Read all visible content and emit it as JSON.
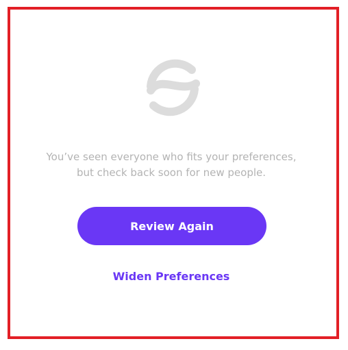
{
  "empty_state": {
    "icon": "swap-circle-icon",
    "message": "You’ve seen everyone who fits your preferences, but check back soon for new people."
  },
  "actions": {
    "review_again_label": "Review Again",
    "widen_preferences_label": "Widen Preferences"
  },
  "colors": {
    "accent": "#6a37f5",
    "icon_gray": "#dcdcdc",
    "message_gray": "#b3b3b3",
    "frame_red": "#e21f26"
  }
}
